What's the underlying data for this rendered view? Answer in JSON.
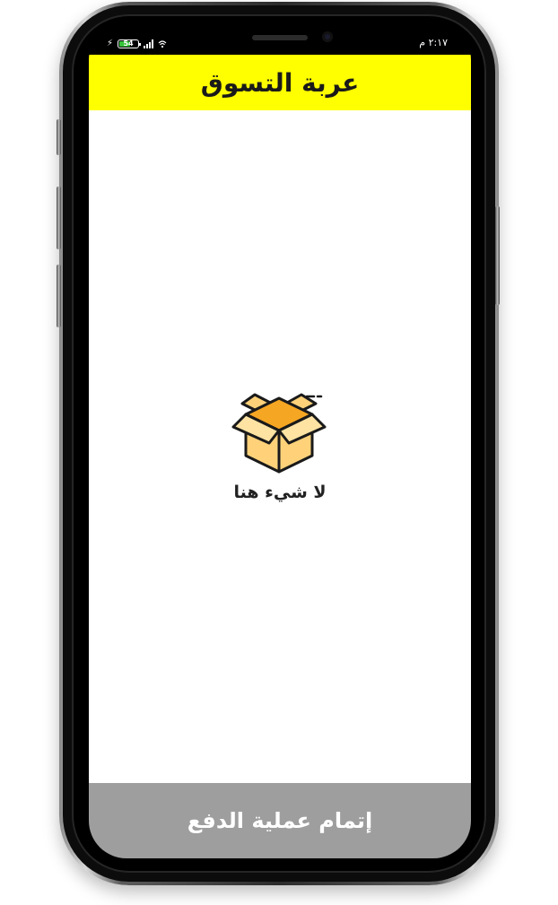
{
  "status_bar": {
    "battery_level": "54",
    "time": "٢:١٧ م"
  },
  "header": {
    "title": "عربة التسوق"
  },
  "cart": {
    "empty_icon": "open-box-icon",
    "empty_message": "لا شيء هنا"
  },
  "footer": {
    "checkout_label": "إتمام عملية الدفع"
  },
  "colors": {
    "header_bg": "#ffff00",
    "checkout_bg": "#9e9e9e",
    "box_light": "#ffd27a",
    "box_dark": "#f5a623",
    "outline": "#1a1a1a"
  }
}
